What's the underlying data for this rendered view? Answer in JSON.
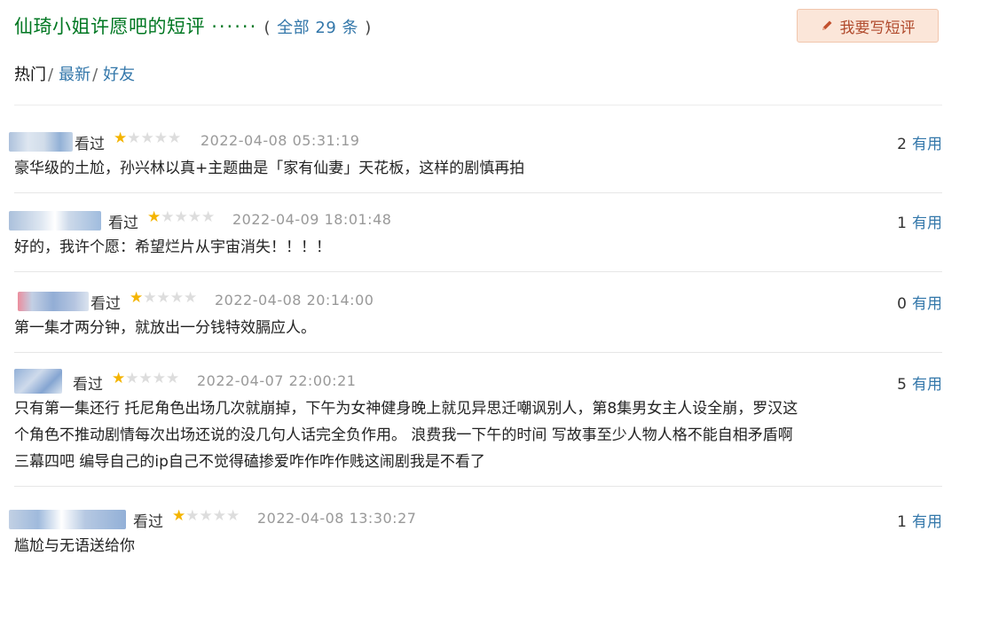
{
  "header": {
    "title": "仙琦小姐许愿吧的短评",
    "dots": "······",
    "open_paren": "(",
    "count_label": "全部 29 条",
    "close_paren": ")",
    "write_button": "我要写短评"
  },
  "tabs": [
    {
      "label": "热门",
      "active": true
    },
    {
      "label": "最新",
      "active": false
    },
    {
      "label": "好友",
      "active": false
    }
  ],
  "tab_separator": "/",
  "watched_label": "看过",
  "useful_label": "有用",
  "rating_max": 5,
  "star_glyph": "★",
  "colors": {
    "star_on": "#f4b400",
    "star_off": "#dddddd",
    "link": "#3377aa",
    "title": "#007722"
  },
  "comments": [
    {
      "rating": 1,
      "time": "2022-04-08 05:31:19",
      "votes": "2",
      "lines": [
        "豪华级的土尬，孙兴林以真+主题曲是「家有仙妻」天花板，这样的剧慎再拍"
      ]
    },
    {
      "rating": 1,
      "time": "2022-04-09 18:01:48",
      "votes": "1",
      "lines": [
        "好的，我许个愿：希望烂片从宇宙消失！！！！"
      ]
    },
    {
      "rating": 1,
      "time": "2022-04-08 20:14:00",
      "votes": "0",
      "lines": [
        "第一集才两分钟，就放出一分钱特效膈应人。"
      ]
    },
    {
      "rating": 1,
      "time": "2022-04-07 22:00:21",
      "votes": "5",
      "lines": [
        "只有第一集还行 托尼角色出场几次就崩掉，下午为女神健身晚上就见异思迁嘲讽别人，第8集男女主人设全崩，罗汉这",
        "个角色不推动剧情每次出场还说的没几句人话完全负作用。 浪费我一下午的时间 写故事至少人物人格不能自相矛盾啊",
        "三幕四吧 编导自己的ip自己不觉得磕掺爱咋作咋作贱这闹剧我是不看了"
      ]
    },
    {
      "rating": 1,
      "time": "2022-04-08 13:30:27",
      "votes": "1",
      "lines": [
        "尴尬与无语送给你"
      ]
    }
  ]
}
